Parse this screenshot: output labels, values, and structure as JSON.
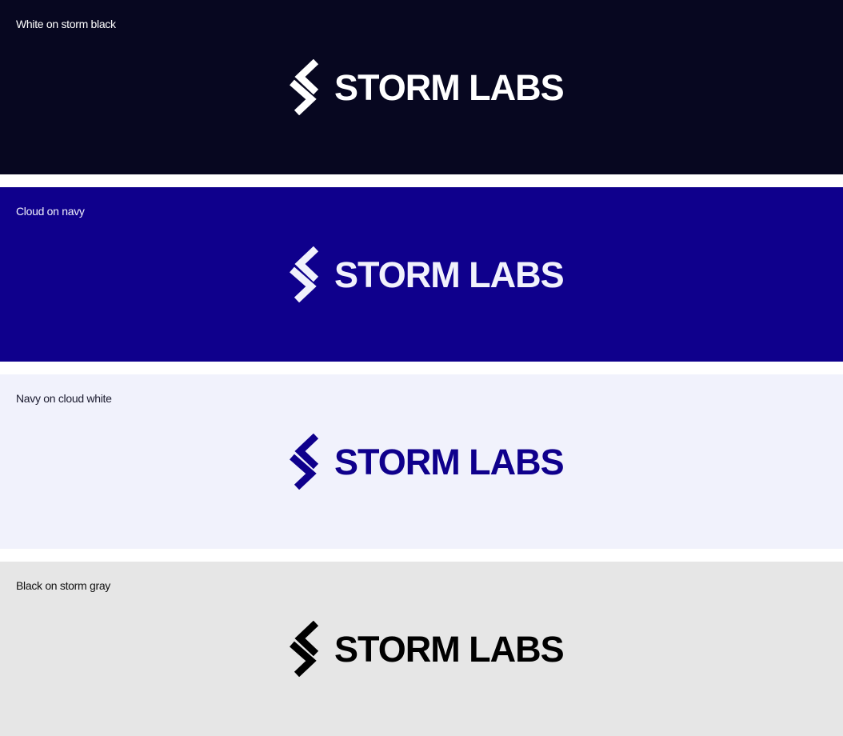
{
  "panels": [
    {
      "label": "White on storm black",
      "wordmark": "STORM LABS",
      "bg": "#070720",
      "fg": "#ffffff",
      "label_color": "#ffffff"
    },
    {
      "label": "Cloud on navy",
      "wordmark": "STORM LABS",
      "bg": "#0f008c",
      "fg": "#f1f1fc",
      "label_color": "#f1f1fc"
    },
    {
      "label": "Navy on cloud white",
      "wordmark": "STORM LABS",
      "bg": "#f1f2fc",
      "fg": "#0f008c",
      "label_color": "#1a1a2e"
    },
    {
      "label": "Black on storm gray",
      "wordmark": "STORM LABS",
      "bg": "#e6e6e6",
      "fg": "#000000",
      "label_color": "#111111"
    }
  ]
}
